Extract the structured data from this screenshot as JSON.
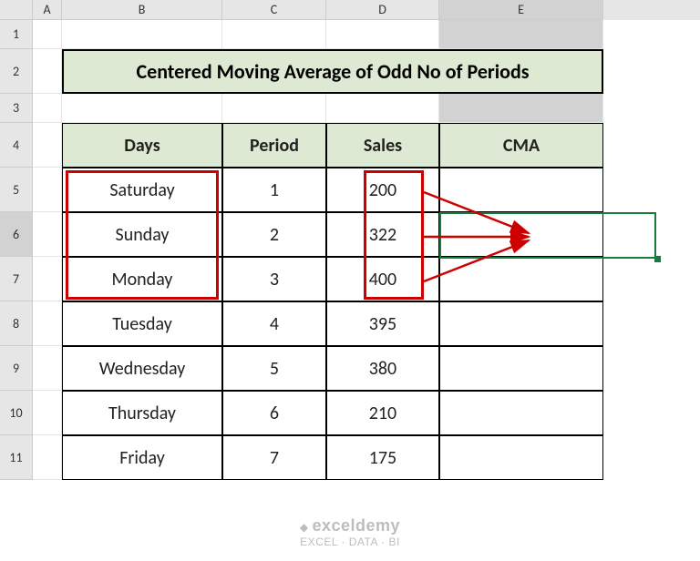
{
  "columns": [
    "A",
    "B",
    "C",
    "D",
    "E"
  ],
  "rows": [
    "1",
    "2",
    "3",
    "4",
    "5",
    "6",
    "7",
    "8",
    "9",
    "10",
    "11"
  ],
  "title": "Centered Moving Average of Odd No of Periods",
  "headers": {
    "days": "Days",
    "period": "Period",
    "sales": "Sales",
    "cma": "CMA"
  },
  "data": [
    {
      "day": "Saturday",
      "period": "1",
      "sales": "200",
      "cma": ""
    },
    {
      "day": "Sunday",
      "period": "2",
      "sales": "322",
      "cma": ""
    },
    {
      "day": "Monday",
      "period": "3",
      "sales": "400",
      "cma": ""
    },
    {
      "day": "Tuesday",
      "period": "4",
      "sales": "395",
      "cma": ""
    },
    {
      "day": "Wednesday",
      "period": "5",
      "sales": "380",
      "cma": ""
    },
    {
      "day": "Thursday",
      "period": "6",
      "sales": "210",
      "cma": ""
    },
    {
      "day": "Friday",
      "period": "7",
      "sales": "175",
      "cma": ""
    }
  ],
  "watermark": {
    "line1": "exceldemy",
    "line2": "EXCEL · DATA · BI"
  },
  "chart_data": {
    "type": "table",
    "title": "Centered Moving Average of Odd No of Periods",
    "columns": [
      "Days",
      "Period",
      "Sales",
      "CMA"
    ],
    "rows": [
      [
        "Saturday",
        1,
        200,
        null
      ],
      [
        "Sunday",
        2,
        322,
        null
      ],
      [
        "Monday",
        3,
        400,
        null
      ],
      [
        "Tuesday",
        4,
        395,
        null
      ],
      [
        "Wednesday",
        5,
        380,
        null
      ],
      [
        "Thursday",
        6,
        210,
        null
      ],
      [
        "Friday",
        7,
        175,
        null
      ]
    ],
    "annotation": "Rows 1–3 (Sales 200, 322, 400) feed into CMA at row 2 (cell E6)"
  }
}
